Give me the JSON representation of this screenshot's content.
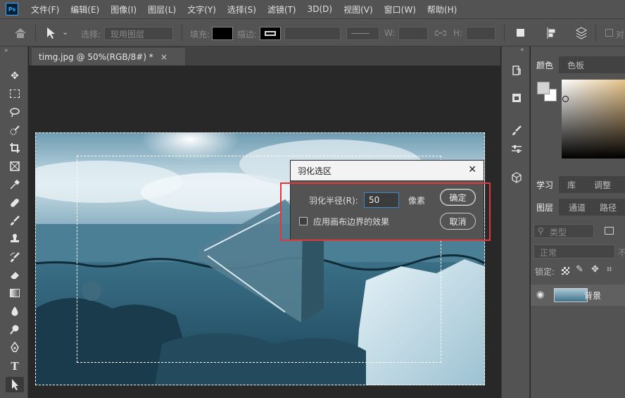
{
  "app": {
    "logo": "Ps"
  },
  "menu": [
    "文件(F)",
    "编辑(E)",
    "图像(I)",
    "图层(L)",
    "文字(Y)",
    "选择(S)",
    "滤镜(T)",
    "3D(D)",
    "视图(V)",
    "窗口(W)",
    "帮助(H)"
  ],
  "options": {
    "select_label": "选择:",
    "select_value": "现用图层",
    "fill_label": "填充:",
    "stroke_label": "描边:",
    "w_label": "W:",
    "h_label": "H:",
    "align_edges_label": "对"
  },
  "document": {
    "tab_title": "timg.jpg @ 50%(RGB/8#) *",
    "close_glyph": "×"
  },
  "panels": {
    "color_tabs": [
      "颜色",
      "色板"
    ],
    "mid_tabs": [
      "学习",
      "库",
      "调整"
    ],
    "layer_tabs": [
      "图层",
      "通道",
      "路径"
    ],
    "filter_placeholder": "类型",
    "blend_mode": "正常",
    "opacity_stub": "不",
    "lock_label": "锁定:",
    "layer_name": "背景"
  },
  "dialog": {
    "title": "羽化选区",
    "radius_label": "羽化半径(R):",
    "radius_value": "50",
    "unit": "像素",
    "checkbox_label": "应用画布边界的效果",
    "ok_label": "确定",
    "cancel_label": "取消",
    "close_glyph": "✕"
  },
  "colors": {
    "highlight": "#e1393b",
    "input_focus": "#3c87c8",
    "ps_blue": "#31a8ff"
  }
}
